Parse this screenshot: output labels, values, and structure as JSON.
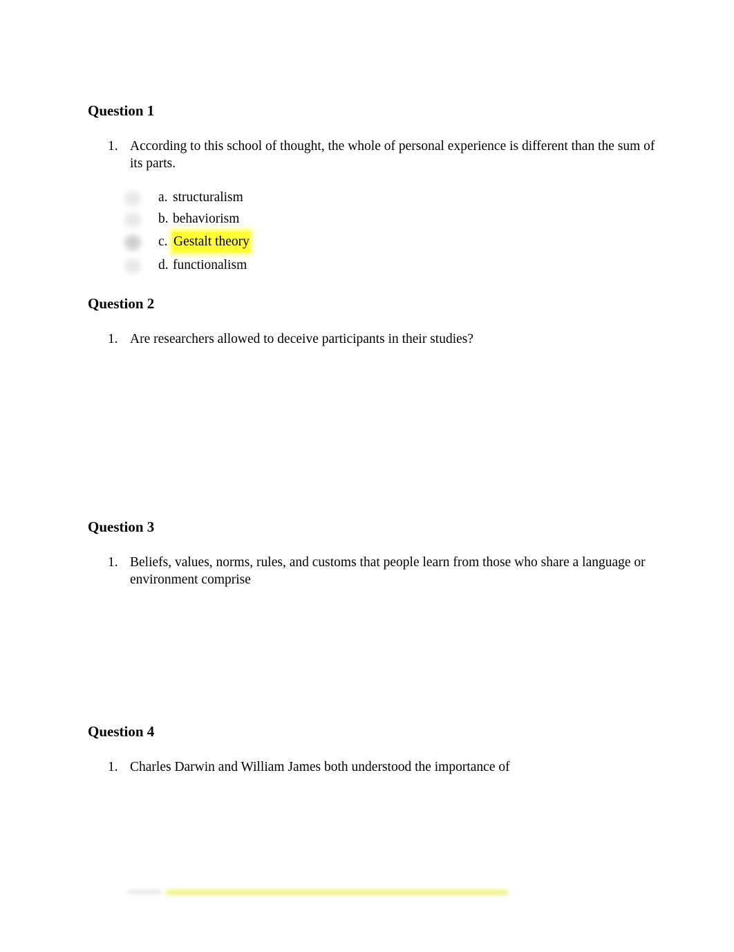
{
  "questions": [
    {
      "heading": "Question 1",
      "number": "1.",
      "text": "According to this school of thought, the whole of personal experience is different than the sum of its parts.",
      "options": [
        {
          "letter": "a.",
          "text": "structuralism",
          "selected": false
        },
        {
          "letter": "b.",
          "text": "behaviorism",
          "selected": false
        },
        {
          "letter": "c.",
          "text": "Gestalt theory",
          "selected": true,
          "highlight_color": "#ffff33"
        },
        {
          "letter": "d.",
          "text": "functionalism",
          "selected": false
        }
      ]
    },
    {
      "heading": "Question 2",
      "number": "1.",
      "text": "Are researchers allowed to deceive participants in their studies?"
    },
    {
      "heading": "Question 3",
      "number": "1.",
      "text": "Beliefs, values, norms, rules, and customs that people learn from those who share a language or environment comprise"
    },
    {
      "heading": "Question 4",
      "number": "1.",
      "text": "Charles Darwin and William James both understood the importance of"
    }
  ]
}
